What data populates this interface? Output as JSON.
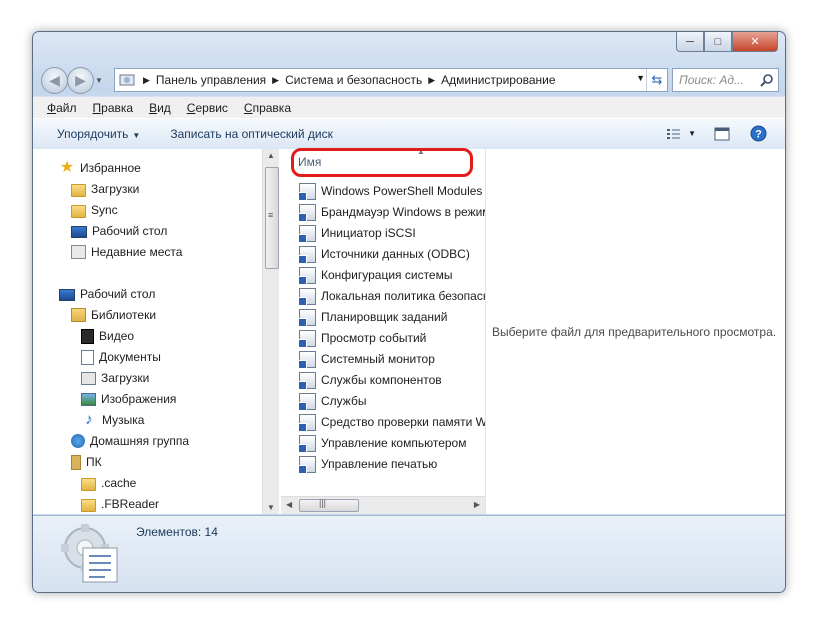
{
  "window": {
    "caption_buttons": {
      "minimize": "▭",
      "maximize": "□",
      "close": "x"
    }
  },
  "address": {
    "crumbs": [
      "Панель управления",
      "Система и безопасность",
      "Администрирование"
    ],
    "search_placeholder": "Поиск: Ад..."
  },
  "menu": [
    "Файл",
    "Правка",
    "Вид",
    "Сервис",
    "Справка"
  ],
  "toolbar": {
    "organize": "Упорядочить",
    "burn": "Записать на оптический диск"
  },
  "nav": {
    "favorites": "Избранное",
    "downloads": "Загрузки",
    "sync": "Sync",
    "desktop": "Рабочий стол",
    "recent": "Недавние места",
    "desktop_root": "Рабочий стол",
    "libraries": "Библиотеки",
    "video": "Видео",
    "documents": "Документы",
    "lib_downloads": "Загрузки",
    "images": "Изображения",
    "music": "Музыка",
    "homegroup": "Домашняя группа",
    "pc": "ПК",
    "cache": ".cache",
    "fbreader": ".FBReader"
  },
  "files": {
    "column": "Имя",
    "items": [
      "Windows PowerShell Modules",
      "Брандмауэр Windows в режим",
      "Инициатор iSCSI",
      "Источники данных (ODBC)",
      "Конфигурация системы",
      "Локальная политика безопасн",
      "Планировщик заданий",
      "Просмотр событий",
      "Системный монитор",
      "Службы компонентов",
      "Службы",
      "Средство проверки памяти W",
      "Управление компьютером",
      "Управление печатью"
    ]
  },
  "preview": {
    "text": "Выберите файл для предварительного просмотра."
  },
  "details": {
    "count": "Элементов: 14"
  }
}
